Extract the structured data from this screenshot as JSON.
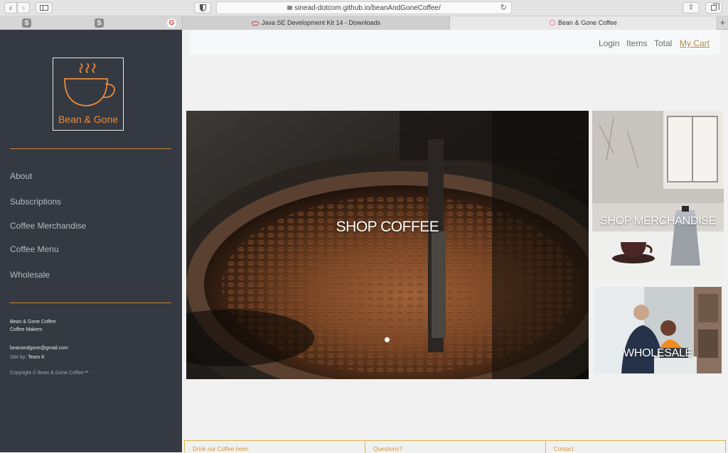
{
  "browser": {
    "url": "sinead-dotcom.github.io/beanAndGoneCoffee/",
    "tabs": [
      {
        "label": "Java SE Development Kit 14 - Downloads"
      },
      {
        "label": "Bean & Gone Coffee"
      }
    ],
    "new_tab": "+",
    "bookmarks": [
      "",
      "S",
      "",
      "",
      "",
      "S",
      "",
      "",
      "",
      "G"
    ]
  },
  "sidebar": {
    "logo_text": "Bean & Gone",
    "nav": [
      {
        "label": "About"
      },
      {
        "label": "Subscriptions"
      },
      {
        "label": "Coffee Merchandise"
      },
      {
        "label": "Coffee Menu"
      },
      {
        "label": "Wholesale"
      }
    ],
    "footer": {
      "company": "Bean & Gone Coffee",
      "tagline": "Coffee Makers",
      "email": "beanandgone@gmail.com",
      "site_by_label": "Site by:",
      "site_by": "Team K",
      "copyright": "Copyright © Bean & Gone Coffee™"
    },
    "colors": {
      "background": "#353a42",
      "accent": "#ea8a3a"
    }
  },
  "topnav": {
    "login": "Login",
    "items": "Items",
    "total": "Total",
    "cart": "My Cart"
  },
  "hero": {
    "label": "SHOP COFFEE",
    "carousel_index": 1
  },
  "tiles": {
    "merch": "SHOP MERCHANDISE",
    "wholesale": "WHOLESALE"
  },
  "footer": {
    "col1": "Drink our Coffee here!",
    "col2": "Questions?",
    "col3": "Contact"
  }
}
